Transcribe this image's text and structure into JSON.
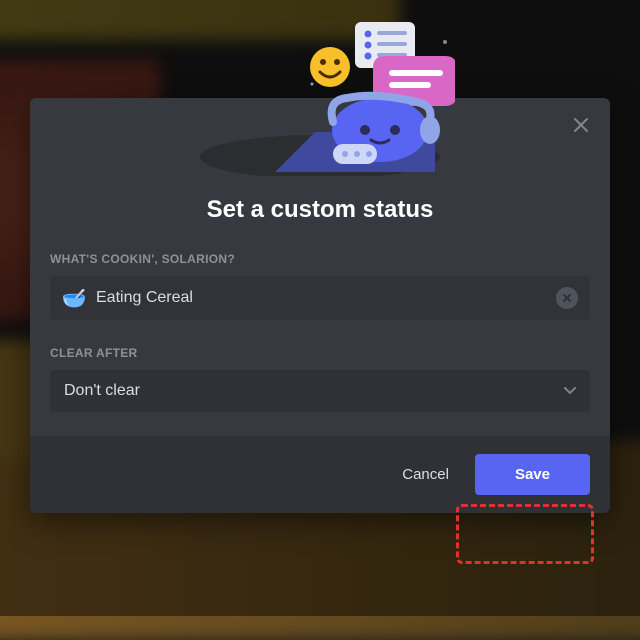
{
  "modal": {
    "title": "Set a custom status",
    "close_label": "Close"
  },
  "status_field": {
    "label": "WHAT'S COOKIN', SOLARION?",
    "emoji": "🥣",
    "value": "Eating Cereal",
    "clear_icon": "clear"
  },
  "clear_after": {
    "label": "CLEAR AFTER",
    "value": "Don't clear"
  },
  "footer": {
    "cancel_label": "Cancel",
    "save_label": "Save"
  }
}
